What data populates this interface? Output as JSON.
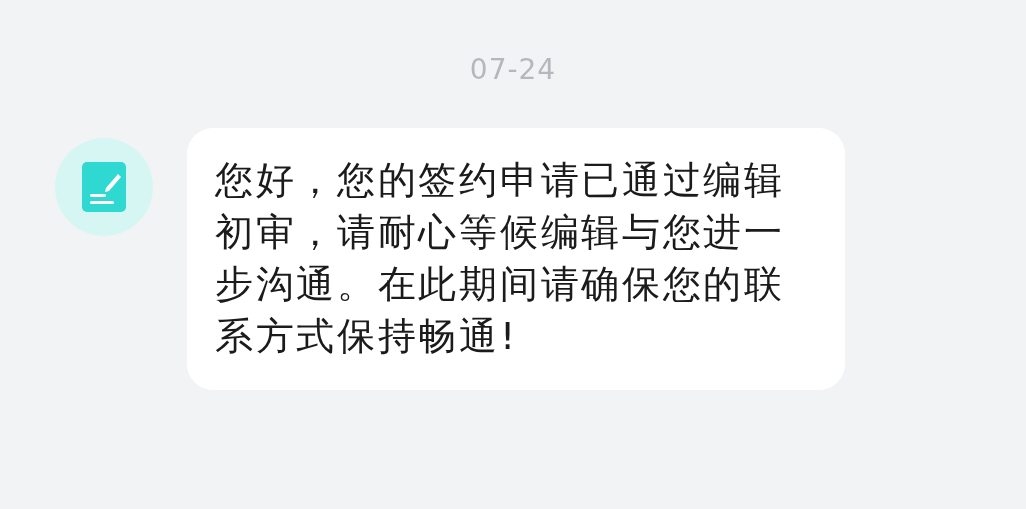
{
  "date": "07-24",
  "messages": [
    {
      "text": "您好，您的签约申请已通过编辑初审，请耐心等候编辑与您进一步沟通。在此期间请确保您的联系方式保持畅通!"
    }
  ]
}
